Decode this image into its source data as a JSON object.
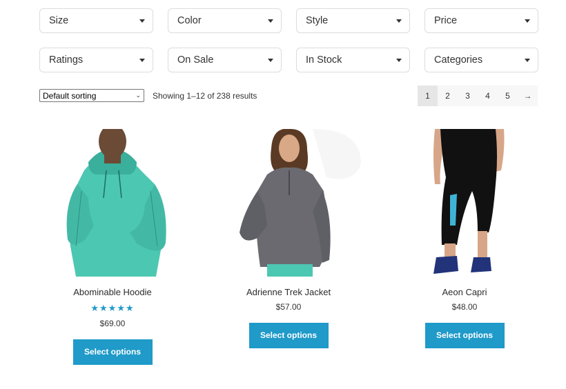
{
  "filters": [
    {
      "label": "Size"
    },
    {
      "label": "Color"
    },
    {
      "label": "Style"
    },
    {
      "label": "Price"
    },
    {
      "label": "Ratings"
    },
    {
      "label": "On Sale"
    },
    {
      "label": "In Stock"
    },
    {
      "label": "Categories"
    }
  ],
  "sorting": {
    "selected": "Default sorting"
  },
  "result_count": "Showing 1–12 of 238 results",
  "pagination": {
    "pages": [
      "1",
      "2",
      "3",
      "4",
      "5"
    ],
    "current": "1",
    "next": "→"
  },
  "products": [
    {
      "title": "Abominable Hoodie",
      "rating_stars": "★★★★★",
      "rating": 5,
      "price": "$69.00",
      "button": "Select options"
    },
    {
      "title": "Adrienne Trek Jacket",
      "price": "$57.00",
      "button": "Select options"
    },
    {
      "title": "Aeon Capri",
      "price": "$48.00",
      "button": "Select options"
    }
  ],
  "colors": {
    "accent": "#1f9ac9"
  }
}
